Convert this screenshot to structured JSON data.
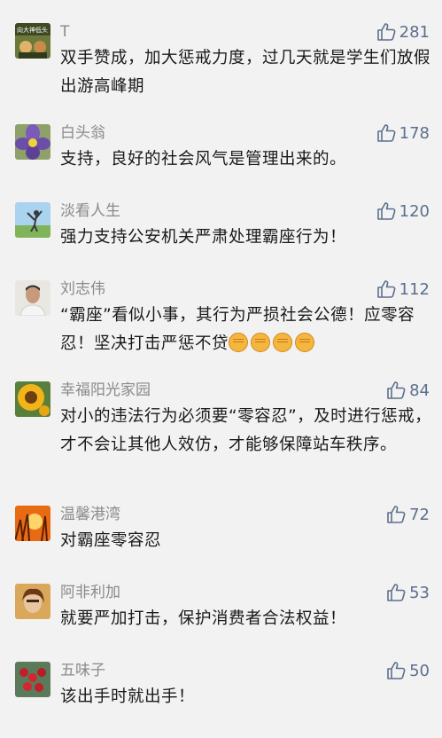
{
  "comments": [
    {
      "user": "T",
      "likes": "281",
      "avatar": "cartoon-avatar",
      "text": "双手赞成，加大惩戒力度，过几天就是学生们放假出游高峰期",
      "avatar_text": "向大神低头"
    },
    {
      "user": "白头翁",
      "likes": "178",
      "avatar": "purple-flower-avatar",
      "text": "支持，良好的社会风气是管理出来的。"
    },
    {
      "user": "淡看人生",
      "likes": "120",
      "avatar": "golf-avatar",
      "text": "强力支持公安机关严肃处理霸座行为！"
    },
    {
      "user": "刘志伟",
      "likes": "112",
      "avatar": "man-portrait-avatar",
      "text": "“霸座”看似小事，其行为严损社会公德！应零容忍！坚决打击严惩不贷",
      "emoji": [
        "fist-emoji",
        "fist-emoji",
        "fist-emoji",
        "fist-emoji"
      ]
    },
    {
      "user": "幸福阳光家园",
      "likes": "84",
      "avatar": "sunflower-avatar",
      "text": "对小的违法行为必须要“零容忍”，及时进行惩戒，才不会让其他人效仿，才能够保障站车秩序。"
    },
    {
      "user": "温馨港湾",
      "likes": "72",
      "avatar": "sunset-grass-avatar",
      "text": "对霸座零容忍"
    },
    {
      "user": "阿非利加",
      "likes": "53",
      "avatar": "woman-portrait-avatar",
      "text": "就要严加打击，保护消费者合法权益！"
    },
    {
      "user": "五味子",
      "likes": "50",
      "avatar": "red-berries-avatar",
      "text": "该出手时就出手！"
    }
  ],
  "colors": {
    "background": "#f2f2f2",
    "username": "#8a8a8a",
    "like": "#5c6f8c",
    "text": "#1a1a1a"
  }
}
